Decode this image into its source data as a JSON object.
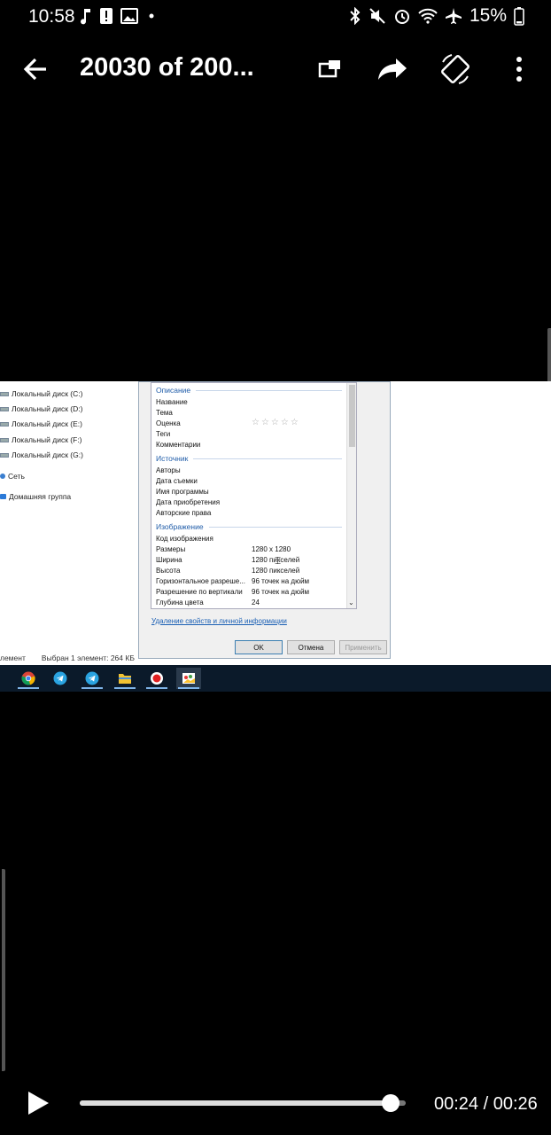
{
  "status_bar": {
    "time": "10:58",
    "battery": "15%",
    "left_icons": [
      "music-note-icon",
      "alert-icon",
      "image-icon",
      "dot-icon"
    ],
    "right_icons": [
      "bluetooth-icon",
      "mute-icon",
      "alarm-icon",
      "wifi-icon",
      "airplane-icon",
      "battery-icon"
    ]
  },
  "appbar": {
    "title": "20030 of 200..."
  },
  "frame": {
    "sidebar": {
      "items": [
        {
          "label": "Локальный диск (C:)"
        },
        {
          "label": "Локальный диск (D:)"
        },
        {
          "label": "Локальный диск (E:)"
        },
        {
          "label": "Локальный диск (F:)"
        },
        {
          "label": "Локальный диск (G:)"
        },
        {
          "label": "Сеть"
        },
        {
          "label": "Домашняя группа"
        }
      ]
    },
    "status_strip": {
      "left": "лемент",
      "selected": "Выбран 1 элемент: 264 КБ"
    },
    "dialog": {
      "groups": {
        "description": "Описание",
        "source": "Источник",
        "image": "Изображение"
      },
      "description_rows": [
        "Название",
        "Тема",
        "Оценка",
        "Теги",
        "Комментарии"
      ],
      "rating_stars": "☆☆☆☆☆",
      "source_rows": [
        "Авторы",
        "Дата съемки",
        "Имя программы",
        "Дата приобретения",
        "Авторские права"
      ],
      "image_rows": [
        {
          "name": "Код изображения",
          "value": ""
        },
        {
          "name": "Размеры",
          "value": "1280 x 1280"
        },
        {
          "name": "Ширина",
          "value": "1280 пикселей"
        },
        {
          "name": "Высота",
          "value": "1280 пикселей"
        },
        {
          "name": "Горизонтальное разреше...",
          "value": "96 точек на дюйм"
        },
        {
          "name": "Разрешение по вертикали",
          "value": "96 точек на дюйм"
        },
        {
          "name": "Глубина цвета",
          "value": "24"
        }
      ],
      "remove_link": "Удаление свойств и личной информации",
      "buttons": {
        "ok": "OK",
        "cancel": "Отмена",
        "apply": "Применить"
      }
    },
    "taskbar_apps": [
      "chrome-icon",
      "telegram-icon",
      "telegram-icon",
      "file-explorer-icon",
      "record-icon",
      "paint-icon"
    ]
  },
  "player": {
    "time_display": "00:24 / 00:26",
    "progress": 0.954
  }
}
